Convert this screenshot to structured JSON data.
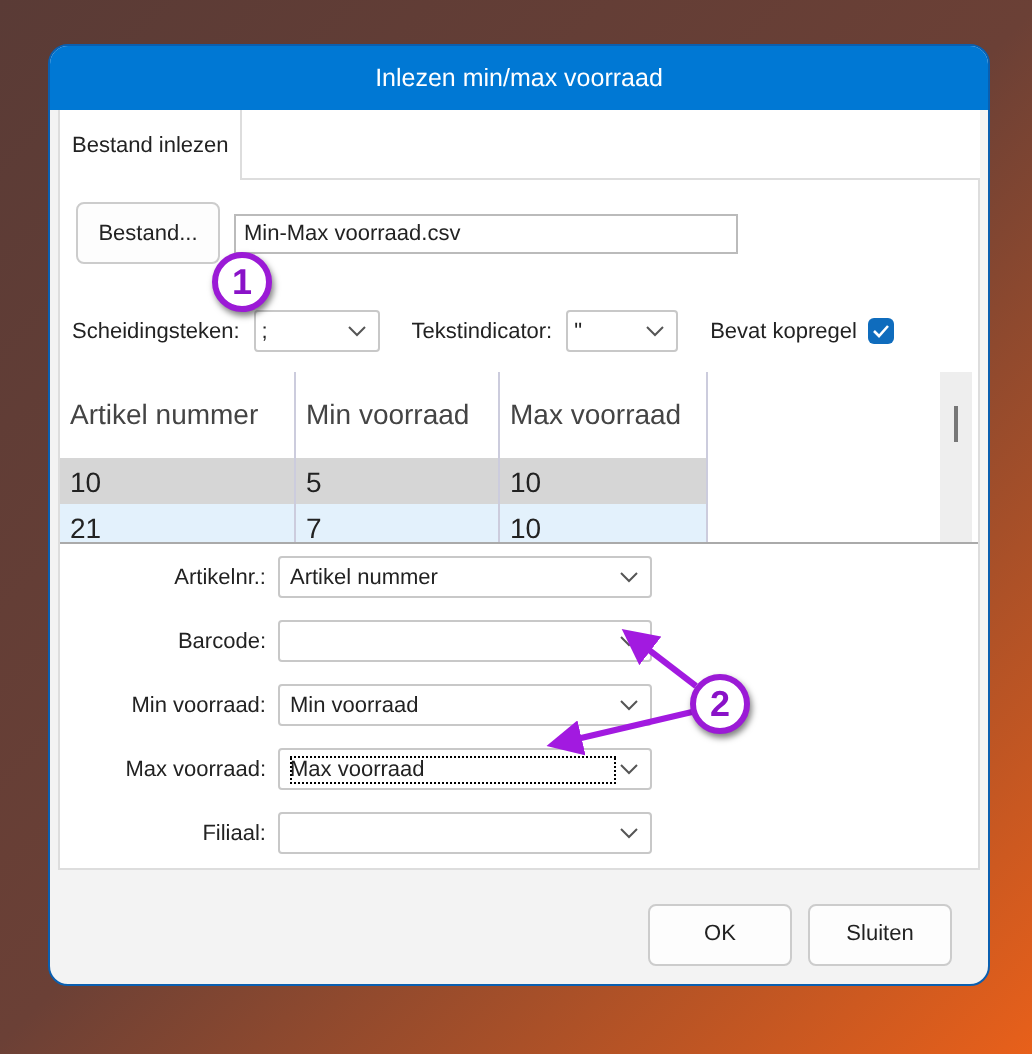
{
  "window": {
    "title": "Inlezen min/max voorraad"
  },
  "tabs": [
    {
      "label": "Bestand inlezen",
      "selected": true
    }
  ],
  "file": {
    "button": "Bestand...",
    "value": "Min-Max voorraad.csv"
  },
  "options": [
    {
      "kind": "select",
      "label": "Scheidingsteken:",
      "value": ";"
    },
    {
      "kind": "select",
      "label": "Tekstindicator:",
      "value": "\""
    },
    {
      "kind": "checkbox",
      "label": "Bevat kopregel",
      "checked": true
    }
  ],
  "grid": {
    "columns": [
      "Artikel nummer",
      "Min voorraad",
      "Max voorraad"
    ],
    "rows": [
      {
        "cells": [
          "10",
          "5",
          "10"
        ],
        "selected": true
      },
      {
        "cells": [
          "21",
          "7",
          "10"
        ],
        "selected": false
      }
    ]
  },
  "mappings": [
    {
      "label": "Artikelnr.:",
      "value": "Artikel nummer",
      "focused": false
    },
    {
      "label": "Barcode:",
      "focused": false
    },
    {
      "label": "Min voorraad:",
      "value": "Min voorraad",
      "focused": false
    },
    {
      "label": "Max voorraad:",
      "value": "Max voorraad",
      "focused": true
    },
    {
      "label": "Filiaal:",
      "focused": false
    }
  ],
  "buttons": [
    "OK",
    "Sluiten"
  ],
  "annotations": [
    {
      "label": "1"
    },
    {
      "label": "2"
    }
  ]
}
